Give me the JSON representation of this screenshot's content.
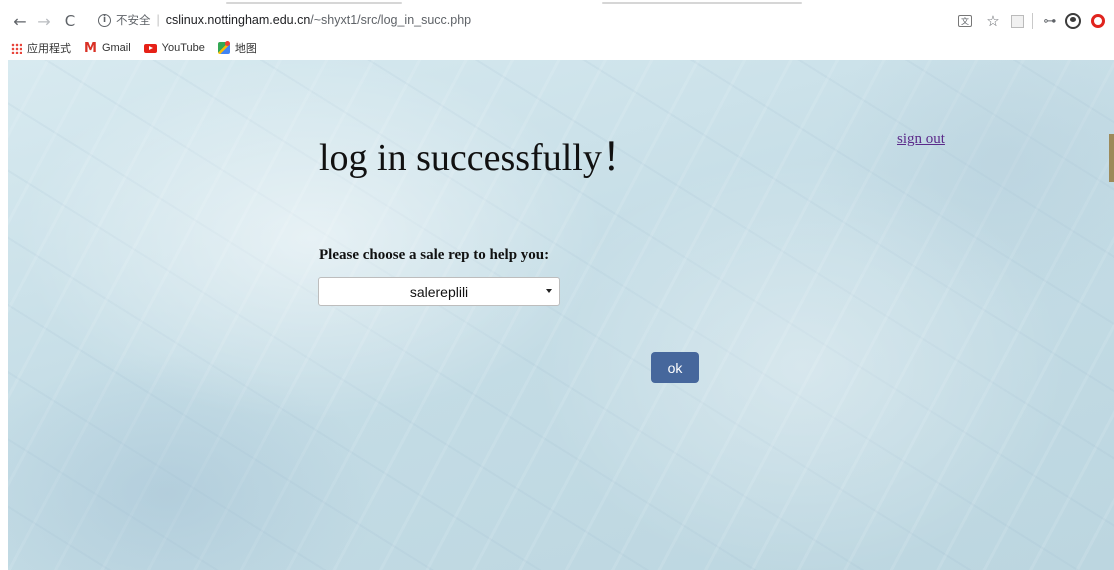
{
  "browser": {
    "url": {
      "security_label": "不安全",
      "host": "cslinux.nottingham.edu.cn",
      "path": "/~shyxt1/src/log_in_succ.php"
    },
    "bookmarks": [
      {
        "label": "应用程式",
        "icon": "apps-icon"
      },
      {
        "label": "Gmail",
        "icon": "gmail-icon"
      },
      {
        "label": "YouTube",
        "icon": "youtube-icon"
      },
      {
        "label": "地图",
        "icon": "maps-icon"
      }
    ]
  },
  "page": {
    "title": "log in successfully！",
    "sign_out_label": "sign out",
    "prompt": "Please choose a sale rep to help you:",
    "sale_rep_select": {
      "selected": "salereplili"
    },
    "ok_label": "ok"
  },
  "colors": {
    "ok_button": "#46679c",
    "link_visited": "#5b2a8a",
    "background": "#c9e1e9"
  }
}
